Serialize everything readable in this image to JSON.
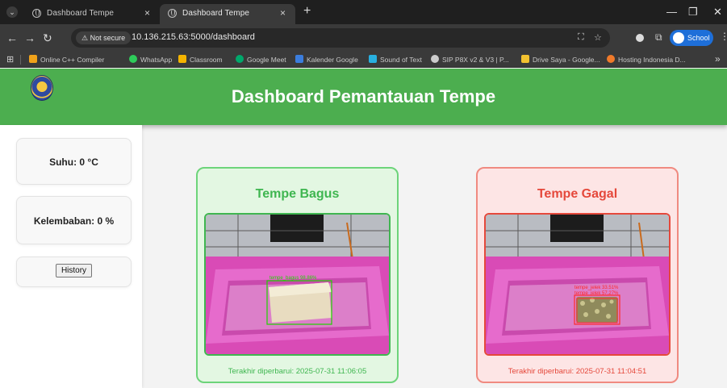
{
  "browser": {
    "tabs": [
      {
        "title": "Dashboard Tempe",
        "active": false
      },
      {
        "title": "Dashboard Tempe",
        "active": true
      }
    ],
    "address": {
      "security_label": "Not secure",
      "url": "10.136.215.63:5000/dashboard"
    },
    "profile_label": "School",
    "bookmarks": [
      {
        "label": "Online C++ Compiler",
        "color": "#f0a21a"
      },
      {
        "label": "WhatsApp",
        "color": "#2ecc5a"
      },
      {
        "label": "Classroom",
        "color": "#f4b400"
      },
      {
        "label": "Google Meet",
        "color": "#00a86b"
      },
      {
        "label": "Kalender Google",
        "color": "#3b7ddd"
      },
      {
        "label": "Sound of Text",
        "color": "#28b0e0"
      },
      {
        "label": "SIP P8X v2 & V3 | P...",
        "color": "#cccccc"
      },
      {
        "label": "Drive Saya - Google...",
        "color": "#f2c230"
      },
      {
        "label": "Hosting Indonesia D...",
        "color": "#f07a2a"
      }
    ]
  },
  "header": {
    "title": "Dashboard Pemantauan Tempe",
    "color": "#4cae4f"
  },
  "sidebar": {
    "suhu": "Suhu: 0 °C",
    "kelembaban": "Kelembaban: 0 %",
    "history_label": "History"
  },
  "panels": {
    "good": {
      "title": "Tempe Bagus",
      "detection_label": "tempe_bagus 98.86%",
      "updated": "Terakhir diperbarui: 2025-07-31 11:06:05"
    },
    "bad": {
      "title": "Tempe Gagal",
      "detection_label_1": "tempe_jelek 33.51%",
      "detection_label_2": "tempe_jelek 57.27%",
      "updated": "Terakhir diperbarui: 2025-07-31 11:04:51"
    }
  }
}
